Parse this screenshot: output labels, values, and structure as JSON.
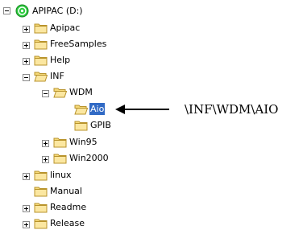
{
  "tree": {
    "root": {
      "label": "APIPAC (D:)",
      "icon": "drive-icon"
    },
    "items": [
      {
        "label": "Apipac",
        "icon": "folder-icon",
        "expander": "plus"
      },
      {
        "label": "FreeSamples",
        "icon": "folder-icon",
        "expander": "plus"
      },
      {
        "label": "Help",
        "icon": "folder-icon",
        "expander": "plus"
      },
      {
        "label": "INF",
        "icon": "folder-open-icon",
        "expander": "minus"
      },
      {
        "label": "WDM",
        "icon": "folder-open-icon",
        "expander": "minus"
      },
      {
        "label": "Aio",
        "icon": "folder-open-icon",
        "selected": true
      },
      {
        "label": "GPIB",
        "icon": "folder-icon"
      },
      {
        "label": "Win95",
        "icon": "folder-icon",
        "expander": "plus"
      },
      {
        "label": "Win2000",
        "icon": "folder-icon",
        "expander": "plus"
      },
      {
        "label": "linux",
        "icon": "folder-icon",
        "expander": "plus"
      },
      {
        "label": "Manual",
        "icon": "folder-icon"
      },
      {
        "label": "Readme",
        "icon": "folder-icon",
        "expander": "plus"
      },
      {
        "label": "Release",
        "icon": "folder-icon",
        "expander": "plus"
      }
    ]
  },
  "annotation": {
    "text": "\\INF\\WDM\\AIO",
    "icon": "arrow-left-icon"
  },
  "colors": {
    "folder": "#f5d97a",
    "folder_edge": "#b8932b",
    "selection": "#316ac5",
    "drive": "#2ecc40"
  }
}
